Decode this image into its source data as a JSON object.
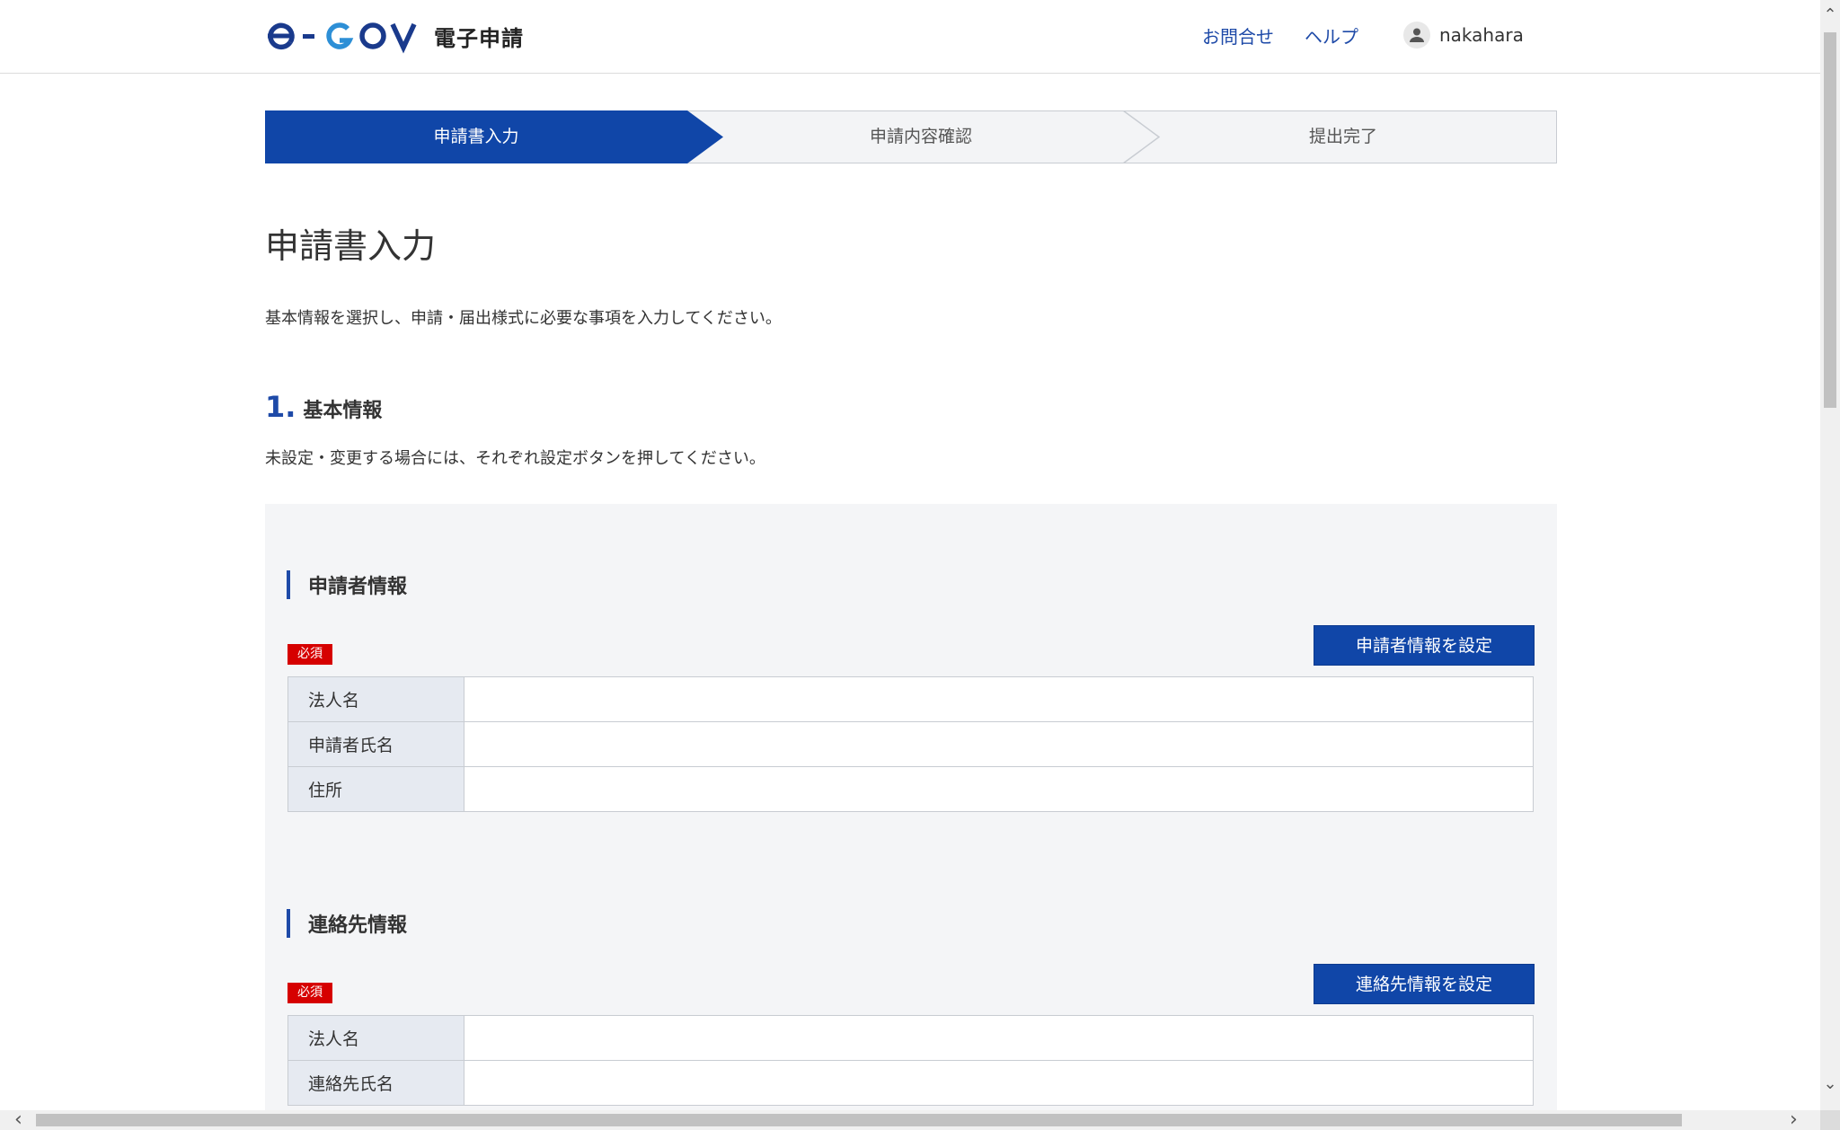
{
  "header": {
    "logo_alt": "e-GOV",
    "service_name": "電子申請",
    "nav": {
      "contact": "お問合せ",
      "help": "ヘルプ"
    },
    "user": {
      "name": "nakahara"
    },
    "accent": "#1e4aa8"
  },
  "steps": [
    {
      "label": "申請書入力",
      "state": "active"
    },
    {
      "label": "申請内容確認",
      "state": "pending"
    },
    {
      "label": "提出完了",
      "state": "pending"
    }
  ],
  "page": {
    "title": "申請書入力",
    "description": "基本情報を選択し、申請・届出様式に必要な事項を入力してください。"
  },
  "section1": {
    "number": "1.",
    "title": "基本情報",
    "description": "未設定・変更する場合には、それぞれ設定ボタンを押してください。"
  },
  "applicant": {
    "title": "申請者情報",
    "required_badge": "必須",
    "button_label": "申請者情報を設定",
    "rows": [
      {
        "label": "法人名",
        "value": ""
      },
      {
        "label": "申請者氏名",
        "value": ""
      },
      {
        "label": "住所",
        "value": ""
      }
    ]
  },
  "contact": {
    "title": "連絡先情報",
    "required_badge": "必須",
    "button_label": "連絡先情報を設定",
    "rows": [
      {
        "label": "法人名",
        "value": ""
      },
      {
        "label": "連絡先氏名",
        "value": ""
      }
    ]
  },
  "colors": {
    "primary": "#1046a8",
    "required": "#d60000",
    "panel_bg": "#f4f5f7",
    "label_bg": "#e6eaf1"
  }
}
